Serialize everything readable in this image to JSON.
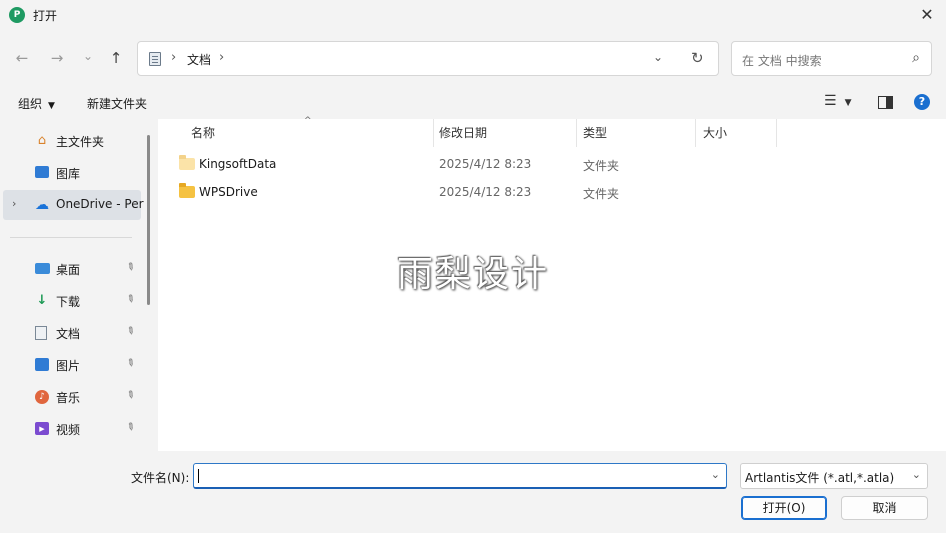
{
  "window": {
    "title": "打开",
    "app_icon_glyph": "P",
    "close_glyph": "✕"
  },
  "nav": {
    "back_glyph": "←",
    "forward_glyph": "→",
    "recent_glyph": "⌄",
    "up_glyph": "↑",
    "breadcrumb": [
      "文档"
    ],
    "sep_glyph": "›",
    "dropdown_glyph": "⌄",
    "refresh_glyph": "↻",
    "search_placeholder": "在 文档 中搜索",
    "search_glyph": "⌕"
  },
  "toolbar": {
    "organize_label": "组织",
    "caret_glyph": "▼",
    "new_folder_label": "新建文件夹",
    "view_glyph": "☰",
    "help_glyph": "?"
  },
  "sidebar": {
    "items": [
      {
        "label": "主文件夹",
        "icon": "home-icon",
        "glyph": "⌂"
      },
      {
        "label": "图库",
        "icon": "gallery-icon"
      },
      {
        "label": "OneDrive - Per",
        "icon": "onedrive-cloud-icon",
        "glyph": "☁",
        "chevron": "›",
        "selected": true
      },
      {
        "label": "桌面",
        "icon": "desktop-icon",
        "pinned": true
      },
      {
        "label": "下载",
        "icon": "download-icon",
        "glyph": "↓",
        "pinned": true
      },
      {
        "label": "文档",
        "icon": "documents-icon",
        "pinned": true
      },
      {
        "label": "图片",
        "icon": "pictures-icon",
        "pinned": true
      },
      {
        "label": "音乐",
        "icon": "music-icon",
        "glyph": "♪",
        "pinned": true
      },
      {
        "label": "视频",
        "icon": "video-icon",
        "glyph": "▶",
        "pinned": true
      }
    ],
    "pin_glyph": "📌"
  },
  "files": {
    "columns": [
      "名称",
      "修改日期",
      "类型",
      "大小"
    ],
    "sort_glyph": "^",
    "rows": [
      {
        "name": "KingsoftData",
        "date": "2025/4/12 8:23",
        "type": "文件夹",
        "size": ""
      },
      {
        "name": "WPSDrive",
        "date": "2025/4/12 8:23",
        "type": "文件夹",
        "size": ""
      }
    ],
    "watermark": "雨梨设计"
  },
  "footer": {
    "filename_label": "文件名(N):",
    "filename_value": "",
    "dropdown_glyph": "⌄",
    "filetype_value": "Artlantis文件 (*.atl,*.atla)",
    "open_label": "打开(O)",
    "cancel_label": "取消"
  },
  "colors": {
    "accent": "#1a6fd0",
    "folder": "#f5c242",
    "selected_bg": "#dde1e6"
  }
}
